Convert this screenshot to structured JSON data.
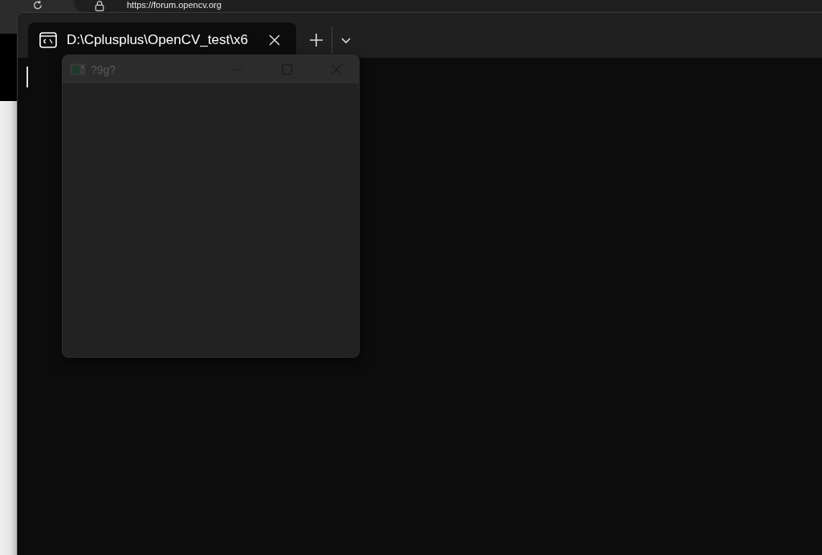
{
  "browser": {
    "url": "https://forum.opencv.org"
  },
  "terminal": {
    "tabs": [
      {
        "title": "D:\\Cplusplus\\OpenCV_test\\x6",
        "selected": true
      }
    ]
  },
  "dialog": {
    "title": "?9g?"
  }
}
